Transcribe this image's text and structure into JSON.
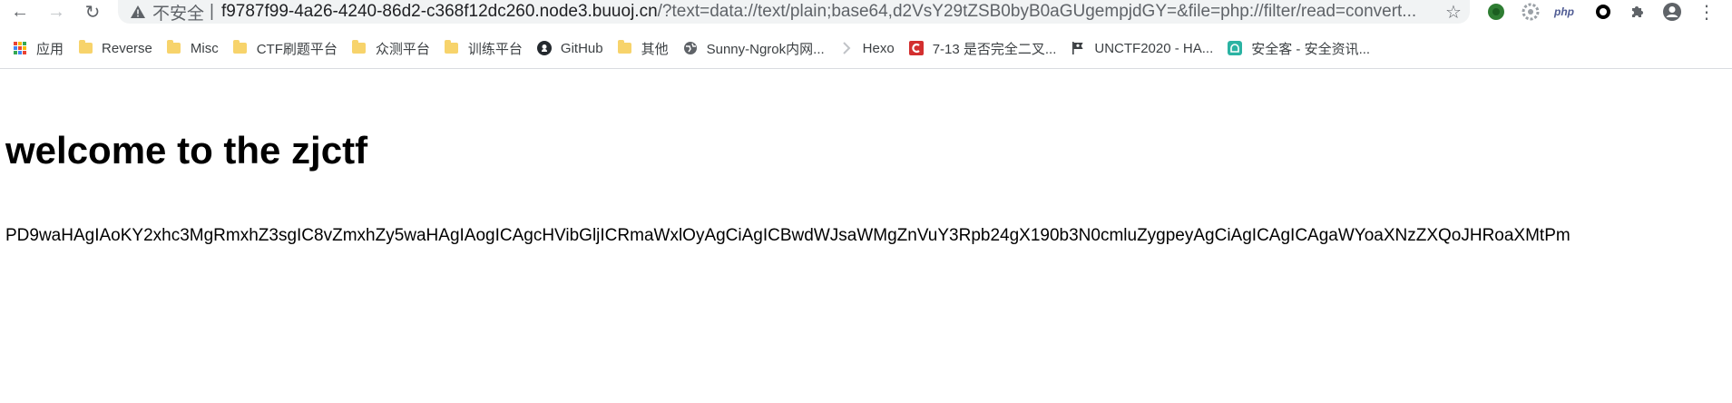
{
  "toolbar": {
    "back_icon": "arrow-left-icon",
    "forward_icon": "arrow-right-icon",
    "reload_icon": "reload-icon",
    "security_icon": "warning-triangle-icon",
    "security_label": "不安全",
    "separator": "|",
    "url_host": "f9787f99-4a26-4240-86d2-c368f12dc260.node3.buuoj.cn",
    "url_rest": "/?text=data://text/plain;base64,d2VsY29tZSB0byB0aGUgempjdGY=&file=php://filter/read=convert...",
    "bookmark_star_icon": "star-icon",
    "extensions": [
      {
        "name": "green-circle-extension-icon",
        "color": "#2e7d32"
      },
      {
        "name": "gear-extension-icon",
        "color": "#9aa0a6"
      },
      {
        "name": "php-extension-icon",
        "label": "php",
        "color": "#4f5b93"
      },
      {
        "name": "ring-extension-icon",
        "color": "#000000"
      },
      {
        "name": "puzzle-extension-icon",
        "color": "#5f6368"
      },
      {
        "name": "profile-avatar-icon",
        "color": "#5f6368"
      },
      {
        "name": "menu-kebab-icon",
        "color": "#5f6368"
      }
    ]
  },
  "bookmarks": [
    {
      "label": "应用",
      "icon": "apps-grid-icon"
    },
    {
      "label": "Reverse",
      "icon": "folder-icon"
    },
    {
      "label": "Misc",
      "icon": "folder-icon"
    },
    {
      "label": "CTF刷题平台",
      "icon": "folder-icon"
    },
    {
      "label": "众测平台",
      "icon": "folder-icon"
    },
    {
      "label": "训练平台",
      "icon": "folder-icon"
    },
    {
      "label": "GitHub",
      "icon": "github-icon"
    },
    {
      "label": "其他",
      "icon": "folder-icon"
    },
    {
      "label": "Sunny-Ngrok内网...",
      "icon": "globe-icon"
    },
    {
      "label": "Hexo",
      "icon": "hexo-icon"
    },
    {
      "label": "7-13 是否完全二叉...",
      "icon": "red-c-icon"
    },
    {
      "label": "UNCTF2020 - HA...",
      "icon": "pirate-flag-icon"
    },
    {
      "label": "安全客 - 安全资讯...",
      "icon": "anquanke-icon"
    }
  ],
  "colors": {
    "folder": "#f7d36b",
    "omnibox_bg": "#f1f3f4",
    "page_text": "#000000"
  },
  "page": {
    "title": "welcome to the zjctf",
    "body_text": "PD9waHAgIAoKY2xhc3MgRmxhZ3sgIC8vZmxhZy5waHAgIAogICAgcHVibGljICRmaWxlOyAgCiAgICBwdWJsaWMgZnVuY3Rpb24gX190b3N0cmluZygpeyAgCiAgICAgICAgaWYoaXNzZXQoJHRoaXMtPm"
  }
}
